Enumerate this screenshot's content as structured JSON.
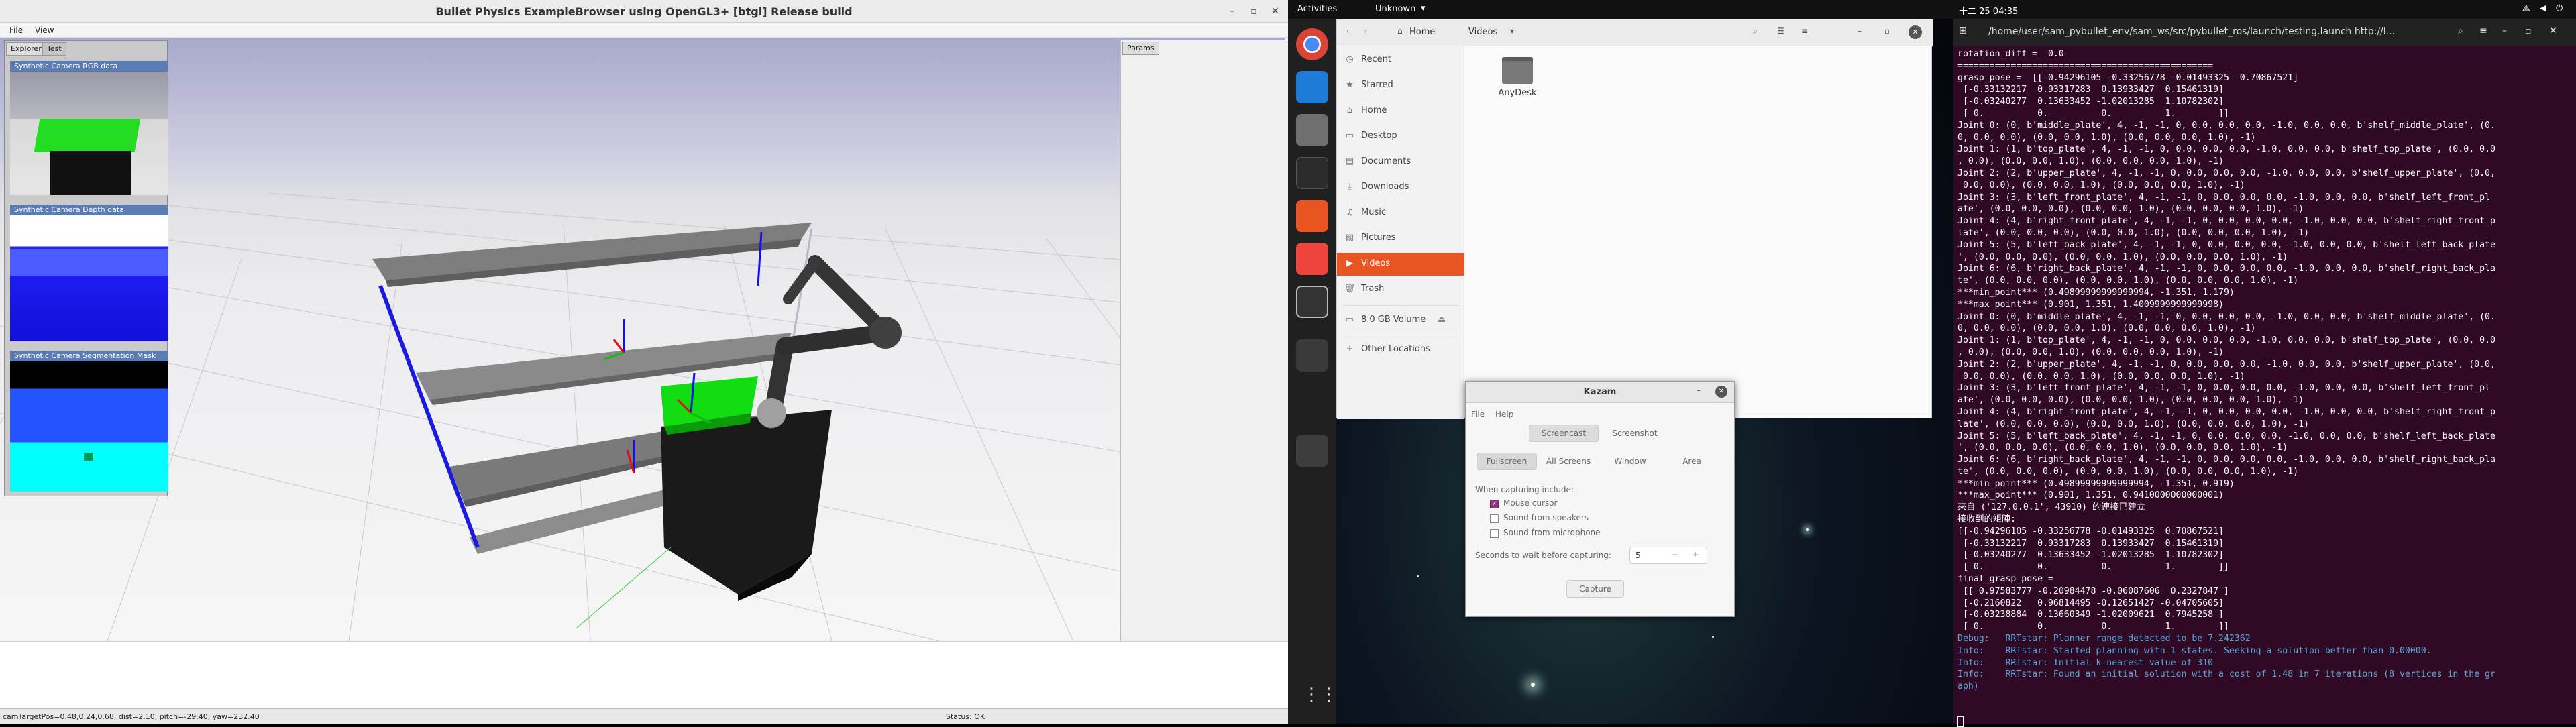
{
  "bullet": {
    "title": "Bullet Physics ExampleBrowser using OpenGL3+ [btgl] Release build",
    "menus": [
      "File",
      "View"
    ],
    "tabs": [
      "Explorer",
      "Test"
    ],
    "cameras": [
      "Synthetic Camera RGB data",
      "Synthetic Camera Depth data",
      "Synthetic Camera Segmentation Mask"
    ],
    "params_tab": "Params",
    "status_left": "camTargetPos=0.48,0.24,0.68, dist=2.10, pitch=-29.40, yaw=232.40",
    "status_right": "Status: OK"
  },
  "topbar": {
    "activities": "Activities",
    "app_menu": "Unknown",
    "clock": "十二 25  04:35"
  },
  "dock": {
    "icons": [
      "chrome-icon",
      "vscode-icon",
      "files-icon",
      "terminal-icon",
      "software-center-icon",
      "anydesk-icon",
      "kazam-icon",
      "blank-app-icon",
      "usb-drive-icon",
      "show-apps-icon"
    ]
  },
  "files": {
    "breadcrumb": [
      "Home",
      "Videos"
    ],
    "sidebar": [
      {
        "label": "Recent",
        "icon": "clock-icon"
      },
      {
        "label": "Starred",
        "icon": "star-icon"
      },
      {
        "label": "Home",
        "icon": "home-icon"
      },
      {
        "label": "Desktop",
        "icon": "desktop-icon"
      },
      {
        "label": "Documents",
        "icon": "document-icon"
      },
      {
        "label": "Downloads",
        "icon": "download-icon"
      },
      {
        "label": "Music",
        "icon": "music-icon"
      },
      {
        "label": "Pictures",
        "icon": "picture-icon"
      },
      {
        "label": "Videos",
        "icon": "video-icon",
        "active": true
      },
      {
        "label": "Trash",
        "icon": "trash-icon"
      },
      {
        "label": "8.0 GB Volume",
        "icon": "drive-icon"
      },
      {
        "label": "Other Locations",
        "icon": "plus-icon"
      }
    ],
    "folder": "AnyDesk"
  },
  "kazam": {
    "title": "Kazam",
    "menus": [
      "File",
      "Help"
    ],
    "modes": [
      "Screencast",
      "Screenshot"
    ],
    "areas": [
      "Fullscreen",
      "All Screens",
      "Window",
      "Area"
    ],
    "capturing_label": "When capturing include:",
    "options": [
      {
        "label": "Mouse cursor",
        "checked": true
      },
      {
        "label": "Sound from speakers",
        "checked": false
      },
      {
        "label": "Sound from microphone",
        "checked": false
      }
    ],
    "wait_label": "Seconds to wait before capturing:",
    "wait_value": "5",
    "capture_button": "Capture"
  },
  "terminal": {
    "title": "/home/user/sam_pybullet_env/sam_ws/src/pybullet_ros/launch/testing.launch http://l...",
    "lines": [
      "rotation_diff =  0.0",
      "================================================",
      "grasp_pose =  [[-0.94296105 -0.33256778 -0.01493325  0.70867521]",
      " [-0.33132217  0.93317283  0.13933427  0.15461319]",
      " [-0.03240277  0.13633452 -1.02013285  1.10782302]",
      " [ 0.          0.          0.          1.        ]]",
      "Joint 0: (0, b'middle_plate', 4, -1, -1, 0, 0.0, 0.0, 0.0, -1.0, 0.0, 0.0, b'shelf_middle_plate', (0.",
      "0, 0.0, 0.0), (0.0, 0.0, 1.0), (0.0, 0.0, 0.0, 1.0), -1)",
      "Joint 1: (1, b'top_plate', 4, -1, -1, 0, 0.0, 0.0, 0.0, -1.0, 0.0, 0.0, b'shelf_top_plate', (0.0, 0.0",
      ", 0.0), (0.0, 0.0, 1.0), (0.0, 0.0, 0.0, 1.0), -1)",
      "Joint 2: (2, b'upper_plate', 4, -1, -1, 0, 0.0, 0.0, 0.0, -1.0, 0.0, 0.0, b'shelf_upper_plate', (0.0,",
      " 0.0, 0.0), (0.0, 0.0, 1.0), (0.0, 0.0, 0.0, 1.0), -1)",
      "Joint 3: (3, b'left_front_plate', 4, -1, -1, 0, 0.0, 0.0, 0.0, -1.0, 0.0, 0.0, b'shelf_left_front_pl",
      "ate', (0.0, 0.0, 0.0), (0.0, 0.0, 1.0), (0.0, 0.0, 0.0, 1.0), -1)",
      "Joint 4: (4, b'right_front_plate', 4, -1, -1, 0, 0.0, 0.0, 0.0, -1.0, 0.0, 0.0, b'shelf_right_front_p",
      "late', (0.0, 0.0, 0.0), (0.0, 0.0, 1.0), (0.0, 0.0, 0.0, 1.0), -1)",
      "Joint 5: (5, b'left_back_plate', 4, -1, -1, 0, 0.0, 0.0, 0.0, -1.0, 0.0, 0.0, b'shelf_left_back_plate",
      "', (0.0, 0.0, 0.0), (0.0, 0.0, 1.0), (0.0, 0.0, 0.0, 1.0), -1)",
      "Joint 6: (6, b'right_back_plate', 4, -1, -1, 0, 0.0, 0.0, 0.0, -1.0, 0.0, 0.0, b'shelf_right_back_pla",
      "te', (0.0, 0.0, 0.0), (0.0, 0.0, 1.0), (0.0, 0.0, 0.0, 1.0), -1)",
      "***min_point*** (0.49899999999999994, -1.351, 1.179)",
      "***max_point*** (0.901, 1.351, 1.4009999999999998)",
      "Joint 0: (0, b'middle_plate', 4, -1, -1, 0, 0.0, 0.0, 0.0, -1.0, 0.0, 0.0, b'shelf_middle_plate', (0.",
      "0, 0.0, 0.0), (0.0, 0.0, 1.0), (0.0, 0.0, 0.0, 1.0), -1)",
      "Joint 1: (1, b'top_plate', 4, -1, -1, 0, 0.0, 0.0, 0.0, -1.0, 0.0, 0.0, b'shelf_top_plate', (0.0, 0.0",
      ", 0.0), (0.0, 0.0, 1.0), (0.0, 0.0, 0.0, 1.0), -1)",
      "Joint 2: (2, b'upper_plate', 4, -1, -1, 0, 0.0, 0.0, 0.0, -1.0, 0.0, 0.0, b'shelf_upper_plate', (0.0,",
      " 0.0, 0.0), (0.0, 0.0, 1.0), (0.0, 0.0, 0.0, 1.0), -1)",
      "Joint 3: (3, b'left_front_plate', 4, -1, -1, 0, 0.0, 0.0, 0.0, -1.0, 0.0, 0.0, b'shelf_left_front_pl",
      "ate', (0.0, 0.0, 0.0), (0.0, 0.0, 1.0), (0.0, 0.0, 0.0, 1.0), -1)",
      "Joint 4: (4, b'right_front_plate', 4, -1, -1, 0, 0.0, 0.0, 0.0, -1.0, 0.0, 0.0, b'shelf_right_front_p",
      "late', (0.0, 0.0, 0.0), (0.0, 0.0, 1.0), (0.0, 0.0, 0.0, 1.0), -1)",
      "Joint 5: (5, b'left_back_plate', 4, -1, -1, 0, 0.0, 0.0, 0.0, -1.0, 0.0, 0.0, b'shelf_left_back_plate",
      "', (0.0, 0.0, 0.0), (0.0, 0.0, 1.0), (0.0, 0.0, 0.0, 1.0), -1)",
      "Joint 6: (6, b'right_back_plate', 4, -1, -1, 0, 0.0, 0.0, 0.0, -1.0, 0.0, 0.0, b'shelf_right_back_pla",
      "te', (0.0, 0.0, 0.0), (0.0, 0.0, 1.0), (0.0, 0.0, 0.0, 1.0), -1)",
      "***min_point*** (0.49899999999999994, -1.351, 0.919)",
      "***max_point*** (0.901, 1.351, 0.9410000000000001)",
      "來自 ('127.0.0.1', 43910) 的連接已建立",
      "接收到的矩陣:",
      "[[-0.94296105 -0.33256778 -0.01493325  0.70867521]",
      " [-0.33132217  0.93317283  0.13933427  0.15461319]",
      " [-0.03240277  0.13633452 -1.02013285  1.10782302]",
      " [ 0.          0.          0.          1.        ]]",
      "final_grasp_pose =",
      " [[ 0.97583777 -0.20984478 -0.06087606  0.2327847 ]",
      " [-0.2160822   0.96814495 -0.12651427 -0.04705605]",
      " [-0.03238884  0.13660349 -1.02009621  0.7945258 ]",
      " [ 0.          0.          0.          1.        ]]"
    ],
    "debug_lines": [
      "Debug:   RRTstar: Planner range detected to be 7.242362",
      "Info:    RRTstar: Started planning with 1 states. Seeking a solution better than 0.00000.",
      "Info:    RRTstar: Initial k-nearest value of 310",
      "Info:    RRTstar: Found an initial solution with a cost of 1.48 in 7 iterations (8 vertices in the gr",
      "aph)"
    ]
  }
}
